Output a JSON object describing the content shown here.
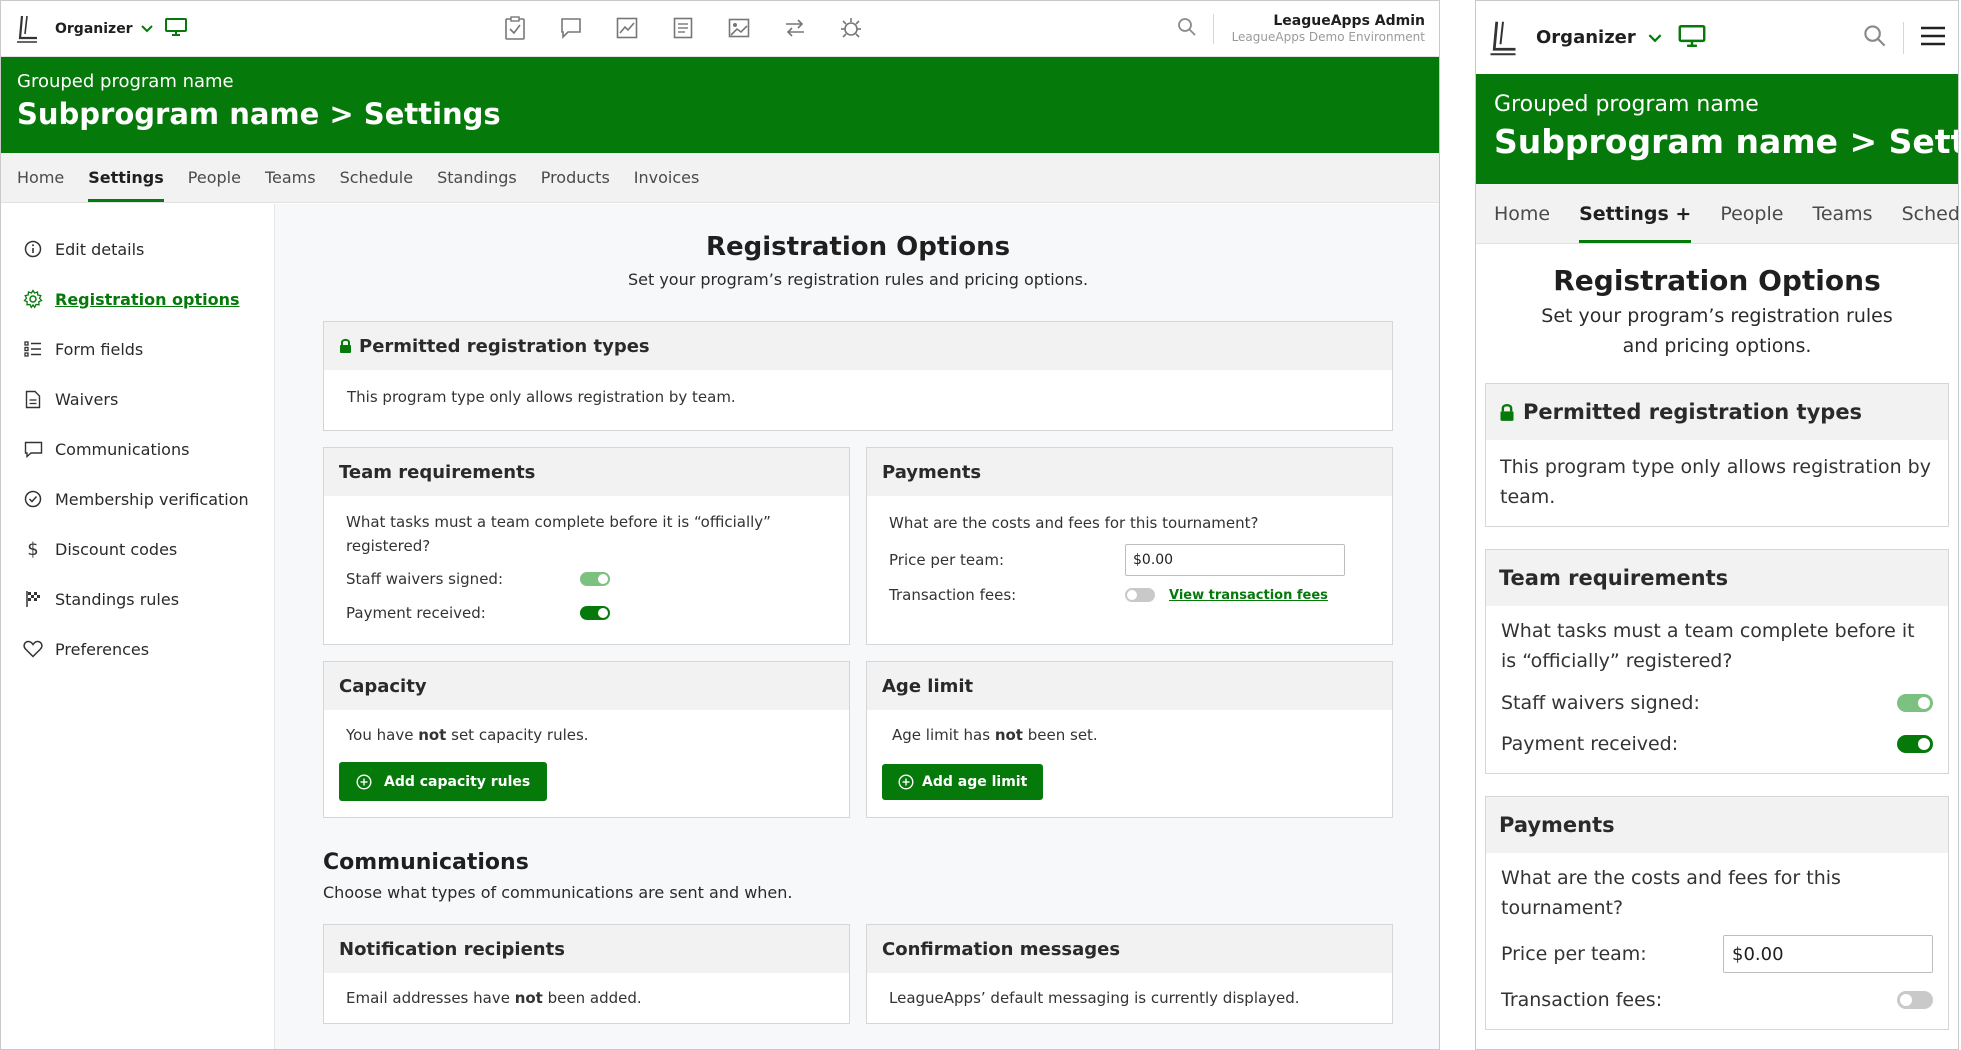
{
  "topbar": {
    "org_label": "Organizer",
    "admin_name": "LeagueApps Admin",
    "admin_env": "LeagueApps Demo Environment",
    "center_icons": [
      "clipboard-check-icon",
      "chat-bubble-icon",
      "trend-chart-icon",
      "document-list-icon",
      "image-icon",
      "swap-arrows-icon",
      "bug-icon"
    ]
  },
  "header": {
    "group_name": "Grouped program name",
    "title": "Subprogram name > Settings"
  },
  "tabs": [
    {
      "label": "Home"
    },
    {
      "label": "Settings"
    },
    {
      "label": "People"
    },
    {
      "label": "Teams"
    },
    {
      "label": "Schedule"
    },
    {
      "label": "Standings"
    },
    {
      "label": "Products"
    },
    {
      "label": "Invoices"
    }
  ],
  "sidebar": {
    "items": [
      {
        "label": "Edit details",
        "icon": "info-icon"
      },
      {
        "label": "Registration options",
        "icon": "gear-icon"
      },
      {
        "label": "Form fields",
        "icon": "list-icon"
      },
      {
        "label": "Waivers",
        "icon": "document-icon"
      },
      {
        "label": "Communications",
        "icon": "chat-icon"
      },
      {
        "label": "Membership verification",
        "icon": "check-circle-icon"
      },
      {
        "label": "Discount codes",
        "icon": "dollar-icon"
      },
      {
        "label": "Standings rules",
        "icon": "checkered-flag-icon"
      },
      {
        "label": "Preferences",
        "icon": "heart-icon"
      }
    ]
  },
  "main": {
    "title": "Registration Options",
    "subtitle": "Set your program’s registration rules and pricing options.",
    "permitted": {
      "title": "Permitted registration types",
      "text": "This program type only allows registration by team."
    },
    "team_req": {
      "title": "Team requirements",
      "question": "What tasks must a team complete before it is “officially” registered?",
      "staff_waivers_label": "Staff waivers signed:",
      "payment_received_label": "Payment received:"
    },
    "payments": {
      "title": "Payments",
      "question": "What are the costs and fees for this tournament?",
      "price_label": "Price per team:",
      "price_value": "$0.00",
      "fees_label": "Transaction fees:",
      "fees_link": "View transaction fees"
    },
    "capacity": {
      "title": "Capacity",
      "text_pre": "You have ",
      "text_bold": "not",
      "text_post": " set capacity rules.",
      "button": "Add capacity rules"
    },
    "age_limit": {
      "title": "Age limit",
      "text_pre": "Age limit has ",
      "text_bold": "not",
      "text_post": " been set.",
      "button": "Add age limit"
    },
    "communications": {
      "title": "Communications",
      "subtitle": "Choose what types of communications are sent and when."
    },
    "notification": {
      "title": "Notification recipients",
      "text_pre": "Email addresses have ",
      "text_bold": "not",
      "text_post": " been added."
    },
    "confirmation": {
      "title": "Confirmation messages",
      "text": "LeagueApps’ default messaging is currently displayed."
    }
  },
  "mobile": {
    "tabs": [
      {
        "label": "Home"
      },
      {
        "label": "Settings +"
      },
      {
        "label": "People"
      },
      {
        "label": "Teams"
      },
      {
        "label": "Sched"
      }
    ]
  },
  "colors": {
    "brand_green": "#057a0b",
    "light_green": "#7cc17f"
  }
}
